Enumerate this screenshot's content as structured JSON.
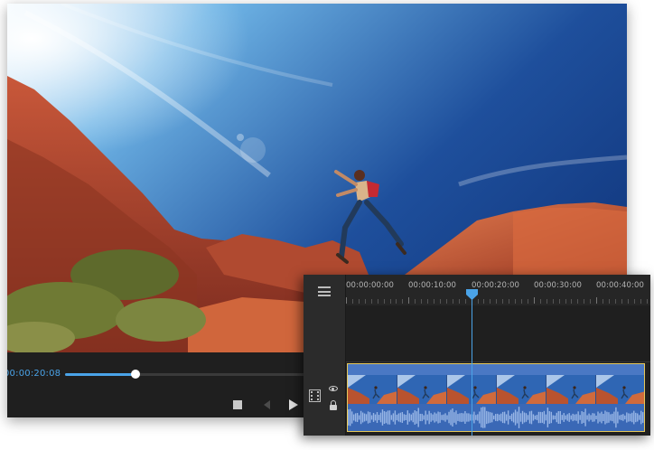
{
  "player": {
    "current_time": "00:00:20:08",
    "seek_progress_fraction": 0.27,
    "controls": [
      "stop-icon",
      "previous-frame-icon",
      "play-icon"
    ]
  },
  "timeline": {
    "ruler_labels": [
      "00:00:00:00",
      "00:00:10:00",
      "00:00:20:00",
      "00:00:30:00",
      "00:00:40:00"
    ],
    "playhead_time": "00:00:20:08",
    "icons": [
      "menu-icon",
      "film-icon",
      "eye-icon",
      "lock-icon"
    ],
    "colors": {
      "playhead": "#4aa3e8",
      "clip": "#3c6bb8",
      "clip_border": "#e6c85a"
    }
  }
}
